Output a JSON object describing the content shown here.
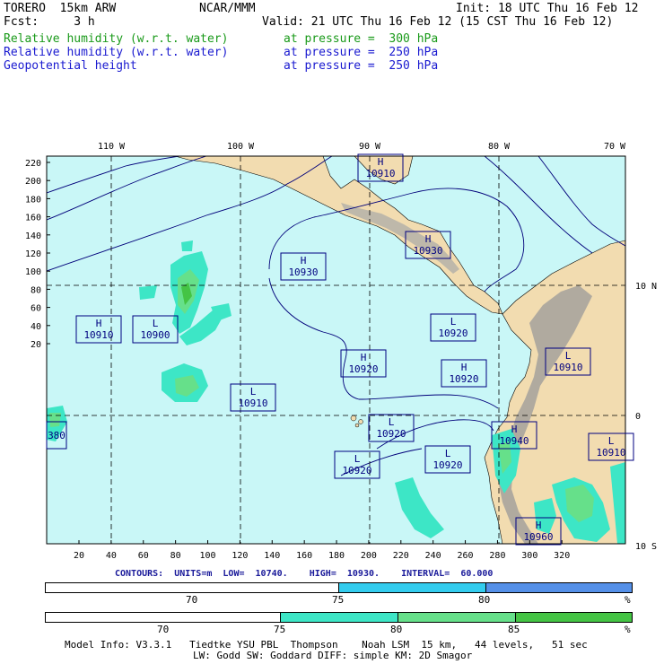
{
  "header": {
    "model": "TORERO  15km ARW",
    "org": "NCAR/MMM",
    "init": "Init: 18 UTC Thu 16 Feb 12",
    "fcst": "Fcst:     3 h",
    "valid": "Valid: 21 UTC Thu 16 Feb 12 (15 CST Thu 16 Feb 12)",
    "fields": [
      {
        "name": "Relative humidity (w.r.t. water)",
        "level": "at pressure =  300 hPa",
        "color": "#1a9a1a"
      },
      {
        "name": "Relative humidity (w.r.t. water)",
        "level": "at pressure =  250 hPa",
        "color": "#1a1ad0"
      },
      {
        "name": "Geopotential height",
        "level": "at pressure =  250 hPa",
        "color": "#000080"
      }
    ]
  },
  "axes": {
    "top_lon": [
      "110 W",
      "100 W",
      "90 W",
      "80 W",
      "70 W"
    ],
    "right_lat": [
      "10 N",
      "0",
      "10 S"
    ],
    "left_y": [
      "220",
      "200",
      "180",
      "160",
      "140",
      "120",
      "100",
      "80",
      "60",
      "40",
      "20"
    ],
    "bottom_x": [
      "20",
      "40",
      "60",
      "80",
      "100",
      "120",
      "140",
      "160",
      "180",
      "200",
      "220",
      "240",
      "260",
      "280",
      "300",
      "320"
    ]
  },
  "centers": [
    {
      "type": "H",
      "value": "10910"
    },
    {
      "type": "H",
      "value": "10930"
    },
    {
      "type": "H",
      "value": "10930"
    },
    {
      "type": "H",
      "value": "10910"
    },
    {
      "type": "L",
      "value": "10900"
    },
    {
      "type": "L",
      "value": "10920"
    },
    {
      "type": "H",
      "value": "10920"
    },
    {
      "type": "H",
      "value": "10920"
    },
    {
      "type": "L",
      "value": "10910"
    },
    {
      "type": "L",
      "value": "10910"
    },
    {
      "type": "L",
      "value": "10920"
    },
    {
      "type": "H",
      "value": "10940"
    },
    {
      "type": "L",
      "value": "10920"
    },
    {
      "type": "L",
      "value": "10920"
    },
    {
      "type": "L",
      "value": "10910"
    },
    {
      "type": "H",
      "value": "10960"
    },
    {
      "type": "",
      "value": "380"
    }
  ],
  "contour_info": "CONTOURS:  UNITS=m  LOW=  10740.    HIGH=  10930.    INTERVAL=  60.000",
  "colorbar1": {
    "ticks": [
      "70",
      "75",
      "80"
    ],
    "unit": "%",
    "colors": [
      "#ffffff",
      "#33ccee",
      "#5590e8"
    ]
  },
  "colorbar2": {
    "ticks": [
      "70",
      "75",
      "80",
      "85"
    ],
    "unit": "%",
    "colors": [
      "#ffffff",
      "#3de6c6",
      "#66e08a",
      "#44c444"
    ]
  },
  "footer": {
    "line1": "Model Info: V3.3.1   Tiedtke YSU PBL  Thompson    Noah LSM  15 km,   44 levels,   51 sec",
    "line2": "LW: Godd SW: Goddard DIFF: simple KM: 2D Smagor"
  }
}
